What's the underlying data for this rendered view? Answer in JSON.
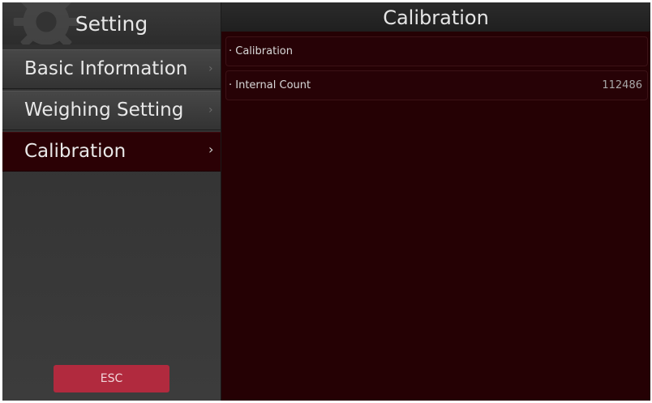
{
  "sidebar": {
    "title": "Setting",
    "items": [
      {
        "label": "Basic Information",
        "chevron": "›"
      },
      {
        "label": "Weighing Setting",
        "chevron": "›"
      },
      {
        "label": "Calibration",
        "chevron": "›"
      }
    ],
    "esc_label": "ESC"
  },
  "main": {
    "title": "Calibration",
    "rows": [
      {
        "label": "· Calibration",
        "value": ""
      },
      {
        "label": "· Internal Count",
        "value": "112486"
      }
    ]
  },
  "colors": {
    "background": "#250104",
    "active_item": "#2b0105",
    "esc_button": "#b12a3e"
  },
  "icons": {
    "header": "gear-icon",
    "item_arrow": "chevron-right-icon"
  }
}
